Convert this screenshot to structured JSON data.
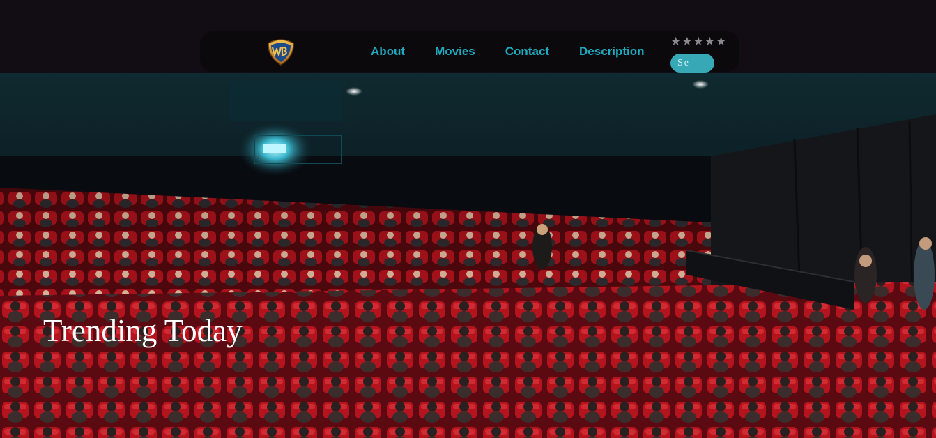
{
  "header": {
    "logo_icon": "wb-shield-logo",
    "nav": [
      {
        "label": "About"
      },
      {
        "label": "Movies"
      },
      {
        "label": "Contact"
      },
      {
        "label": "Description"
      }
    ],
    "rating": {
      "stars": [
        "★",
        "★",
        "★",
        "★",
        "★"
      ],
      "icon": "star-icon"
    },
    "search": {
      "value": "Se",
      "placeholder": ""
    }
  },
  "hero": {
    "title": "Trending Today",
    "image": "cinema-audience-photo"
  },
  "colors": {
    "background": "#120d15",
    "navbar": "#0c090c",
    "link": "#1eaabf",
    "search": "#37a9b6",
    "seat_red": "#b3141e"
  }
}
